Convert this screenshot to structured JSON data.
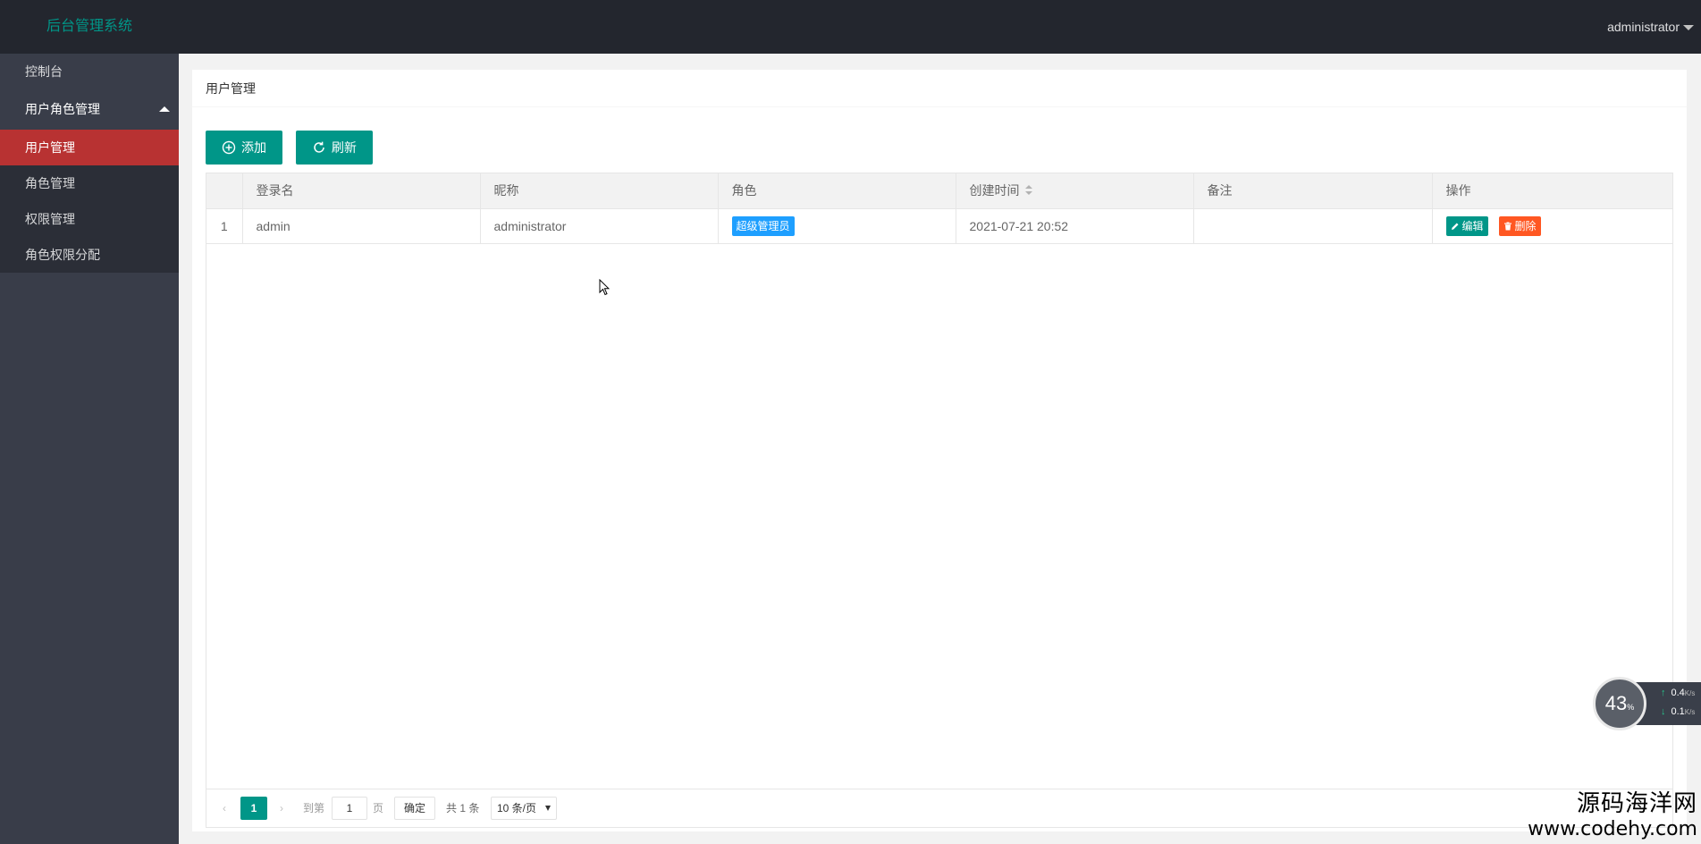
{
  "header": {
    "logo": "后台管理系统",
    "user": "administrator"
  },
  "sidebar": {
    "items": [
      {
        "label": "控制台"
      },
      {
        "label": "用户角色管理",
        "expanded": true
      }
    ],
    "children": [
      {
        "label": "用户管理",
        "active": true
      },
      {
        "label": "角色管理"
      },
      {
        "label": "权限管理"
      },
      {
        "label": "角色权限分配"
      }
    ]
  },
  "main": {
    "title": "用户管理",
    "toolbar": {
      "add_label": "添加",
      "refresh_label": "刷新"
    },
    "table": {
      "columns": [
        "",
        "登录名",
        "昵称",
        "角色",
        "创建时间",
        "备注",
        "操作"
      ],
      "rows": [
        {
          "index": "1",
          "login": "admin",
          "nickname": "administrator",
          "role": "超级管理员",
          "created": "2021-07-21 20:52",
          "remark": "",
          "edit_label": "编辑",
          "delete_label": "删除"
        }
      ]
    },
    "pager": {
      "current": "1",
      "goto_label": "到第",
      "goto_value": "1",
      "page_label": "页",
      "confirm_label": "确定",
      "total_label": "共 1 条",
      "page_size": "10 条/页"
    }
  },
  "widget": {
    "percent": "43",
    "percent_unit": "%",
    "up_rate": "0.4",
    "down_rate": "0.1",
    "rate_unit": "K/s"
  },
  "watermark": {
    "line1": "源码海洋网",
    "line2": "www.codehy.com"
  },
  "colors": {
    "accent": "#009688",
    "header_bg": "#23262e",
    "sidebar_bg": "#393d49",
    "active_nav": "#b83232",
    "badge": "#1e9fff",
    "danger": "#ff5722"
  }
}
